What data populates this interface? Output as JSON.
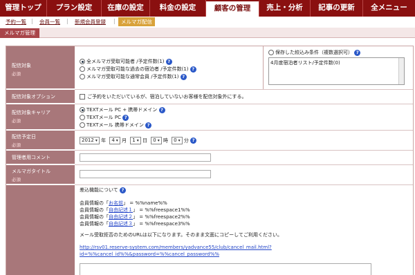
{
  "topnav": {
    "tabs": [
      {
        "label": "管理トップ"
      },
      {
        "label": "プラン設定"
      },
      {
        "label": "在庫の設定"
      },
      {
        "label": "料金の設定"
      },
      {
        "label": "顧客の管理"
      },
      {
        "label": "売上・分析"
      },
      {
        "label": "記事の更新"
      },
      {
        "label": "全メニュー"
      }
    ],
    "active": "顧客の管理"
  },
  "subnav": {
    "items": [
      {
        "label": "予約一覧"
      },
      {
        "label": "会員一覧"
      },
      {
        "label": "新規会員登録"
      },
      {
        "label": "メルマガ配信"
      }
    ],
    "separator": "|",
    "active": "メルマガ配信"
  },
  "page_title": "メルマガ管理",
  "required_mark": "必須",
  "help_glyph": "?",
  "target": {
    "label": "配信対象",
    "options": [
      {
        "text": "全メルマガ受取可能者",
        "count": "/予定件数(1)",
        "selected": true
      },
      {
        "text": "メルマガ受取可能な過去の宿泊者",
        "count": "/予定件数(1)",
        "selected": false
      },
      {
        "text": "メルマガ受取可能な通常会員",
        "count": "/予定件数(1)",
        "selected": false
      }
    ],
    "saved_condition_label": "保存した絞込み条件（複数選択可）",
    "saved_list": [
      "4月度宿泊者リスト/予定件数(0)"
    ]
  },
  "target_option": {
    "label": "配信対象オプション",
    "checkbox_text": "ご予約をいただいているが、宿泊していないお客様を配信対象外にする。"
  },
  "carrier": {
    "label": "配信対象キャリア",
    "options": [
      {
        "text": "TEXTメール PC + 携帯ドメイン",
        "selected": true
      },
      {
        "text": "TEXTメール PC",
        "selected": false
      },
      {
        "text": "TEXTメール 携帯ドメイン",
        "selected": false
      }
    ]
  },
  "schedule": {
    "label": "配信予定日",
    "year": "2012",
    "year_unit": "年",
    "month": "4",
    "month_unit": "月",
    "day": "1",
    "day_unit": "日",
    "hour": "0",
    "hour_unit": "時",
    "minute": "0",
    "minute_unit": "分"
  },
  "admin_comment": {
    "label": "管理者用コメント",
    "value": ""
  },
  "mag_title": {
    "label": "メルマガタイトル",
    "value": ""
  },
  "body": {
    "insert_title": "差込機能について",
    "insert_lines": [
      {
        "prefix": "会員情報の「",
        "link": "お名前",
        "suffix": "」 = %%name%%"
      },
      {
        "prefix": "会員情報の「",
        "link": "自由記述１",
        "suffix": "」 = %%freespace1%%"
      },
      {
        "prefix": "会員情報の「",
        "link": "自由記述２",
        "suffix": "」 = %%freespace2%%"
      },
      {
        "prefix": "会員情報の「",
        "link": "自由記述３",
        "suffix": "」 = %%freespace3%%"
      }
    ],
    "cancel_note": "メール受取拒否のためのURLは以下になります。そのまま文面にコピーしてご利用ください。",
    "cancel_url_line1": "http://rsv01.reserve-system.com/members/yadvance55/club/cancel_mail.html?",
    "cancel_url_line2": "id=%%cancel_id%%&password=%%cancel_password%%"
  },
  "colors": {
    "nav": "#8a1010",
    "label_bg": "#a8777a",
    "accent_sub": "#d9a23a",
    "help": "#2a58c8"
  }
}
